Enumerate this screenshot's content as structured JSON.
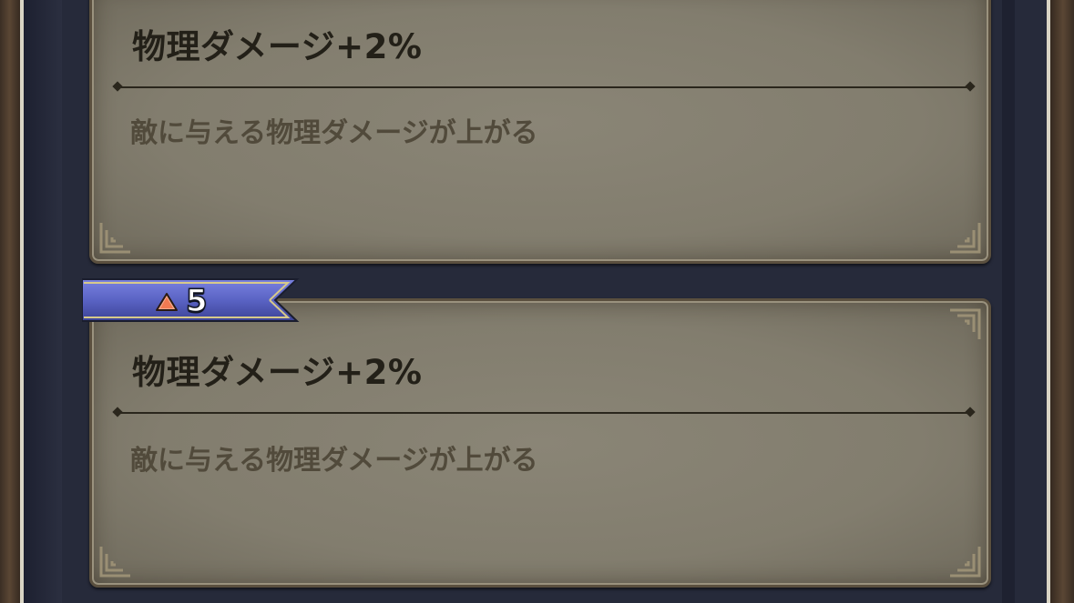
{
  "perks": [
    {
      "title": "物理ダメージ+2%",
      "description": "敵に与える物理ダメージが上がる"
    },
    {
      "level_badge": "5",
      "title": "物理ダメージ+2%",
      "description": "敵に与える物理ダメージが上がる"
    }
  ],
  "colors": {
    "card_fill": "#827d6e",
    "card_border": "#5a4f3e",
    "title_text": "#232018",
    "desc_text": "#514a3b",
    "ribbon_blue": "#5a63c4",
    "ribbon_gold": "#d7c98a",
    "background": "#262a3a"
  },
  "icons": {
    "level_icon": "orange-triangle-icon",
    "card_corner": "corner-ornament-icon"
  }
}
